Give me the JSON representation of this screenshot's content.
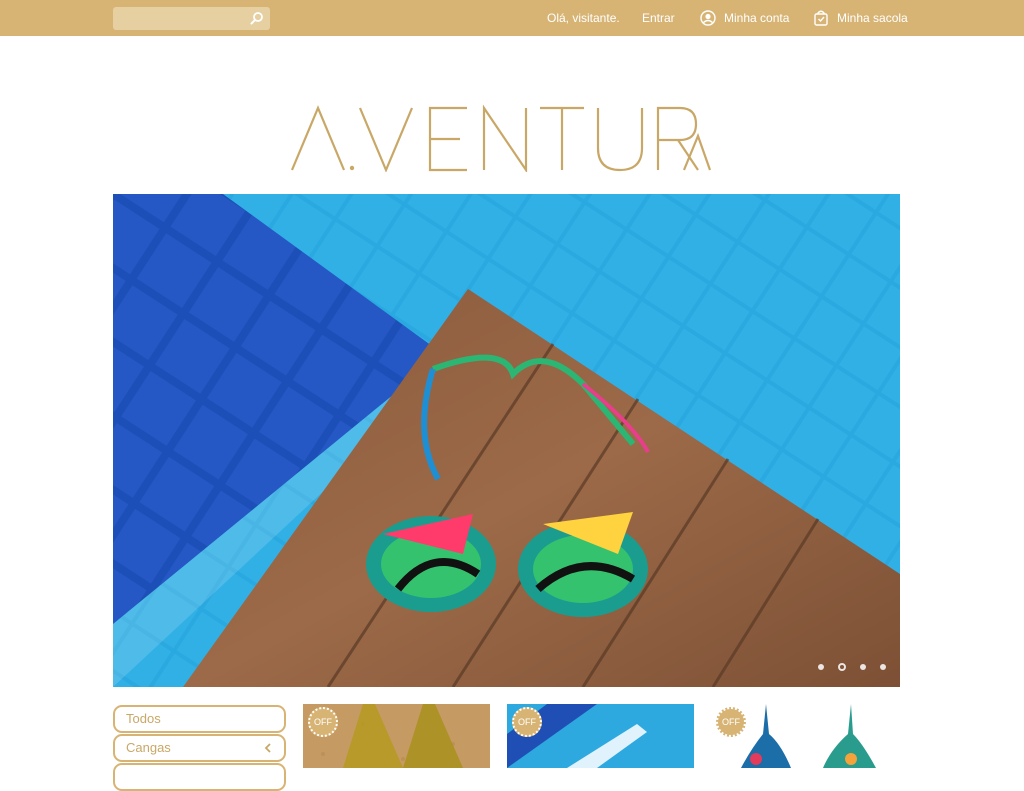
{
  "header": {
    "search": {
      "placeholder": ""
    },
    "greeting": "Olá, visitante.",
    "login": "Entrar",
    "account": "Minha conta",
    "bag": "Minha sacola",
    "colors": {
      "bar": "#d7b474",
      "text": "#ffffff"
    },
    "icons": {
      "search": "magnifier-icon",
      "account": "user-circle-icon",
      "bag": "shopping-bag-icon"
    }
  },
  "brand": {
    "logo_text": "A.VENTURA",
    "color": "#c9a867"
  },
  "hero": {
    "image": "bikini-top-on-wooden-pool-deck",
    "slides": 4,
    "active_slide": 2
  },
  "sidebar": {
    "categories": [
      {
        "label": "Todos"
      },
      {
        "label": "Cangas"
      },
      {
        "label": ""
      }
    ]
  },
  "products": [
    {
      "badge": "OFF",
      "image": "olive-bikini-on-cork"
    },
    {
      "badge": "OFF",
      "image": "pool-tiles-product"
    },
    {
      "badge": "OFF",
      "image": "printed-bikini-top"
    }
  ]
}
